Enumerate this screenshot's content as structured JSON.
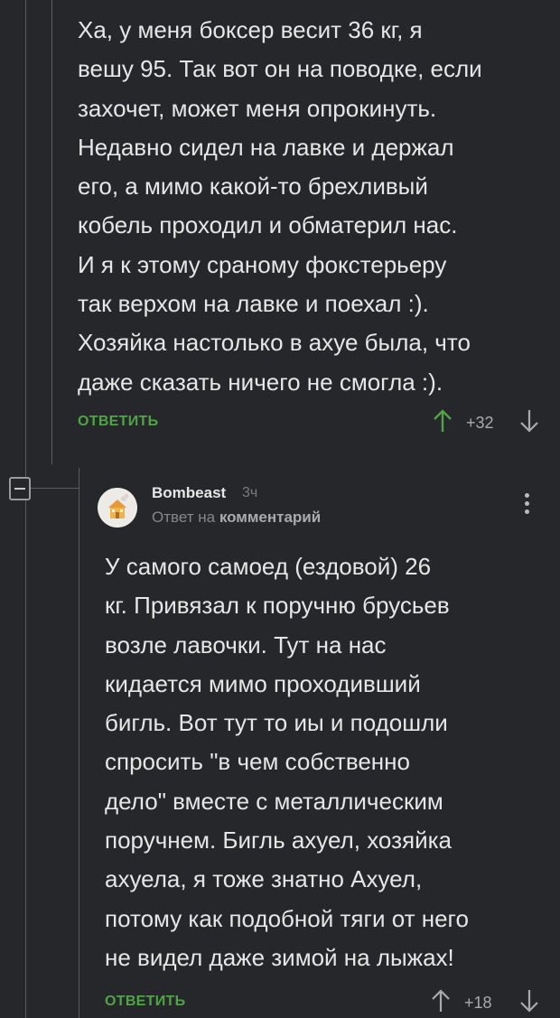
{
  "comment1": {
    "text": "Ха, у меня боксер весит 36 кг, я\nвешу 95. Так вот он на поводке, если\nзахочет, может меня опрокинуть.\nНедавно сидел на лавке и держал\nего, а мимо какой-то брехливый\nкобель проходил и обматерил нас.\nИ я к этому сраному фокстерьеру\nтак верхом на лавке и поехал :).\nХозяйка настолько в ахуе была, что\nдаже сказать ничего не смогла :).",
    "reply_label": "ОТВЕТИТЬ",
    "rating": "+32"
  },
  "comment2": {
    "author": "Bombeast",
    "time": "3ч",
    "reply_to_prefix": "Ответ на",
    "reply_to_target": "комментарий",
    "text": "У самого самоед (ездовой) 26\nкг. Привязал к поручню брусьев\nвозле лавочки. Тут на нас\nкидается мимо проходивший\nбигль. Вот тут то иы и подошли\nспросить \"в чем собственно\nдело\" вместе с металлическим\nпоручнем. Бигль ахуел, хозяйка\nахуела, я тоже знатно Ахуел,\nпотому как подобной тяги от него\nне видел даже зимой на лыжах!",
    "reply_label": "ОТВЕТИТЬ",
    "rating": "+18"
  },
  "colors": {
    "background": "#26272a",
    "accent_green": "#4fa446",
    "text": "#e6e6e6",
    "muted": "#a9aaad"
  },
  "icons": [
    "collapse-icon",
    "arrow-up-icon",
    "arrow-down-icon",
    "more-vertical-icon",
    "avatar-house-icon"
  ]
}
